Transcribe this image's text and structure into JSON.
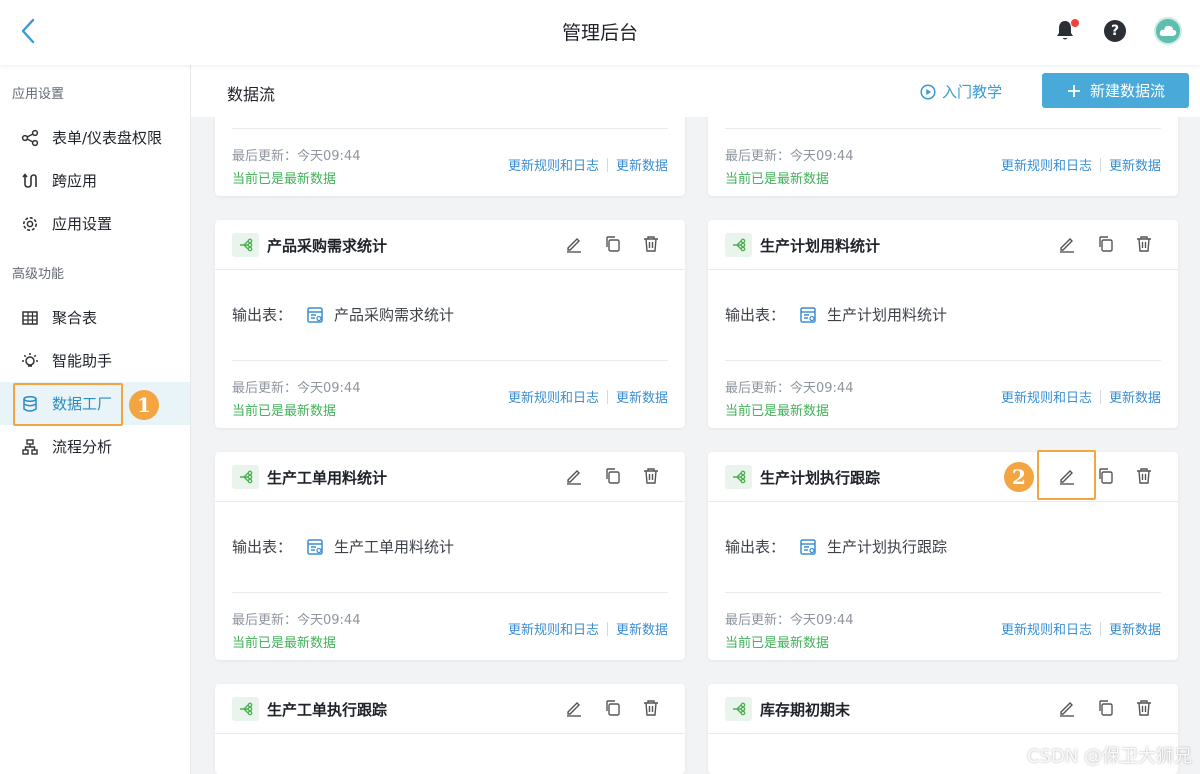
{
  "header": {
    "title": "管理后台"
  },
  "sidebar": {
    "groups": [
      {
        "label": "应用设置",
        "items": [
          {
            "label": "表单/仪表盘权限",
            "icon": "share-icon"
          },
          {
            "label": "跨应用",
            "icon": "cross-app-icon"
          },
          {
            "label": "应用设置",
            "icon": "gear-icon"
          }
        ]
      },
      {
        "label": "高级功能",
        "items": [
          {
            "label": "聚合表",
            "icon": "table-grid-icon"
          },
          {
            "label": "智能助手",
            "icon": "bulb-icon"
          },
          {
            "label": "数据工厂",
            "icon": "database-icon",
            "active": true
          },
          {
            "label": "流程分析",
            "icon": "org-chart-icon"
          }
        ]
      }
    ]
  },
  "annotations": {
    "badge1": "1",
    "badge2": "2"
  },
  "content": {
    "title": "数据流",
    "tutorial_label": "入门教学",
    "new_button_label": "新建数据流"
  },
  "cards": [
    {
      "title": "",
      "output_label": "",
      "output_table": "",
      "updated": "最后更新：今天09:44",
      "status": "当前已是最新数据",
      "link_rules": "更新规则和日志",
      "link_update": "更新数据"
    },
    {
      "title": "",
      "output_label": "",
      "output_table": "",
      "updated": "最后更新：今天09:44",
      "status": "当前已是最新数据",
      "link_rules": "更新规则和日志",
      "link_update": "更新数据"
    },
    {
      "title": "产品采购需求统计",
      "output_label": "输出表：",
      "output_table": "产品采购需求统计",
      "updated": "最后更新：今天09:44",
      "status": "当前已是最新数据",
      "link_rules": "更新规则和日志",
      "link_update": "更新数据"
    },
    {
      "title": "生产计划用料统计",
      "output_label": "输出表：",
      "output_table": "生产计划用料统计",
      "updated": "最后更新：今天09:44",
      "status": "当前已是最新数据",
      "link_rules": "更新规则和日志",
      "link_update": "更新数据"
    },
    {
      "title": "生产工单用料统计",
      "output_label": "输出表：",
      "output_table": "生产工单用料统计",
      "updated": "最后更新：今天09:44",
      "status": "当前已是最新数据",
      "link_rules": "更新规则和日志",
      "link_update": "更新数据"
    },
    {
      "title": "生产计划执行跟踪",
      "output_label": "输出表：",
      "output_table": "生产计划执行跟踪",
      "updated": "最后更新：今天09:44",
      "status": "当前已是最新数据",
      "link_rules": "更新规则和日志",
      "link_update": "更新数据"
    },
    {
      "title": "生产工单执行跟踪",
      "output_label": "",
      "output_table": "",
      "updated": "",
      "status": "",
      "link_rules": "",
      "link_update": ""
    },
    {
      "title": "库存期初期末",
      "output_label": "",
      "output_table": "",
      "updated": "",
      "status": "",
      "link_rules": "",
      "link_update": ""
    }
  ],
  "watermark": "CSDN @保卫大狮兄",
  "colors": {
    "accent": "#49a9d8",
    "highlight": "#f2a541",
    "success": "#42b25a",
    "link": "#3a8ed4"
  }
}
